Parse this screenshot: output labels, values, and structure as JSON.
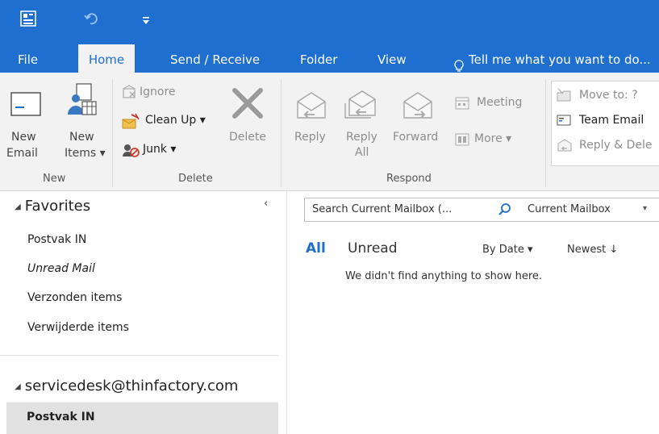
{
  "tabs": [
    "File",
    "Home",
    "Send / Receive",
    "Folder",
    "View"
  ],
  "tell_me": "Tell me what you want to do...",
  "ribbon": {
    "new_email": [
      "New",
      "Email"
    ],
    "new_items": [
      "New",
      "Items ▾"
    ],
    "ignore": "Ignore",
    "clean_up": "Clean Up ▾",
    "junk": "Junk ▾",
    "delete": "Delete",
    "reply": "Reply",
    "reply_all": [
      "Reply",
      "All"
    ],
    "forward": "Forward",
    "meeting": "Meeting",
    "more": "More ▾",
    "move_to": "Move to: ?",
    "team_email": "Team Email",
    "reply_delete": "Reply & Dele",
    "groups": {
      "new": "New",
      "delete": "Delete",
      "respond": "Respond"
    }
  },
  "nav": {
    "favorites": "Favorites",
    "items": [
      "Postvak IN",
      "Unread Mail",
      "Verzonden items",
      "Verwijderde items"
    ],
    "account": "servicedesk@thinfactory.com",
    "account_item": "Postvak IN"
  },
  "search": {
    "placeholder": "Search Current Mailbox (...",
    "scope": "Current Mailbox"
  },
  "filters": {
    "all": "All",
    "unread": "Unread",
    "by_date": "By Date ▾",
    "newest": "Newest ↓"
  },
  "empty_message": "We didn't find anything to show here."
}
